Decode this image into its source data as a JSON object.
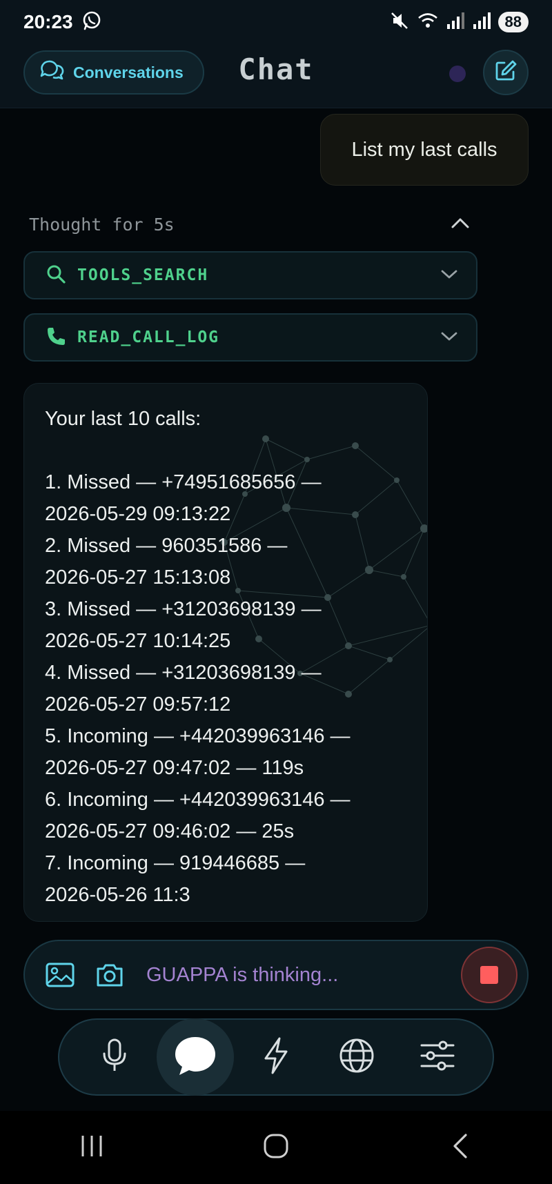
{
  "status_bar": {
    "time": "20:23",
    "battery": "88",
    "icons": [
      "whatsapp-icon",
      "mute-icon",
      "wifi-icon",
      "signal-icon",
      "signal-icon"
    ]
  },
  "header": {
    "conversations_label": "Conversations",
    "title": "Chat"
  },
  "messages": {
    "user_message": "List my last calls",
    "thought_label": "Thought for 5s",
    "tools": [
      {
        "name": "TOOLS_SEARCH",
        "icon": "search-icon"
      },
      {
        "name": "READ_CALL_LOG",
        "icon": "phone-icon"
      }
    ],
    "reply_intro": "Your last 10 calls:",
    "calls": [
      {
        "line1": "1. Missed — +74951685656 —",
        "line2": "2026-05-29 09:13:22"
      },
      {
        "line1": "2. Missed — 960351586 —",
        "line2": "2026-05-27 15:13:08"
      },
      {
        "line1": "3. Missed — +31203698139 —",
        "line2": "2026-05-27 10:14:25"
      },
      {
        "line1": "4. Missed — +31203698139 —",
        "line2": "2026-05-27 09:57:12"
      },
      {
        "line1": "5. Incoming — +442039963146 —",
        "line2": "2026-05-27 09:47:02 — 119s"
      },
      {
        "line1": "6. Incoming — +442039963146 —",
        "line2": "2026-05-27 09:46:02 — 25s"
      },
      {
        "line1": "7. Incoming — 919446685 —",
        "line2": "2026-05-26 11:3"
      }
    ]
  },
  "composer": {
    "status_text": "GUAPPA is thinking..."
  },
  "dock": {
    "items": [
      "microphone-icon",
      "chat-bubble-icon",
      "lightning-icon",
      "globe-icon",
      "sliders-icon"
    ],
    "active": "chat-bubble-icon"
  },
  "colors": {
    "accent_cyan": "#5fd4ea",
    "tool_green": "#4fd18c",
    "thinking_purple": "#a483d1",
    "stop_red": "#ff5e5e"
  }
}
